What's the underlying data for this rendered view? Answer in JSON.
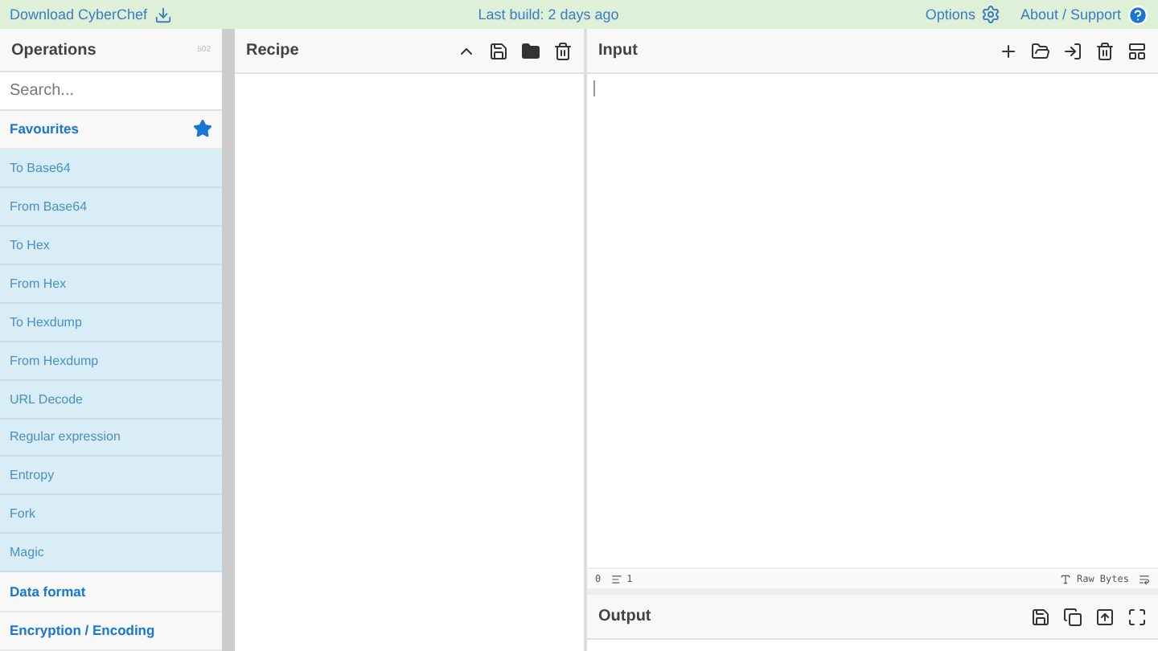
{
  "top_bar": {
    "download": "Download CyberChef",
    "build": "Last build: 2 days ago",
    "options": "Options",
    "about": "About / Support"
  },
  "operations": {
    "title": "Operations",
    "count": "502",
    "search": {
      "placeholder": "Search..."
    },
    "categories": [
      {
        "label": "Favourites",
        "expanded": true,
        "items": [
          "To Base64",
          "From Base64",
          "To Hex",
          "From Hex",
          "To Hexdump",
          "From Hexdump",
          "URL Decode",
          "Regular expression",
          "Entropy",
          "Fork",
          "Magic"
        ]
      },
      {
        "label": "Data format",
        "expanded": false
      },
      {
        "label": "Encryption / Encoding",
        "expanded": false
      }
    ]
  },
  "recipe": {
    "title": "Recipe"
  },
  "input": {
    "title": "Input",
    "status": {
      "length": "0",
      "lines": "1",
      "encoding": "Raw Bytes"
    }
  },
  "output": {
    "title": "Output"
  }
}
